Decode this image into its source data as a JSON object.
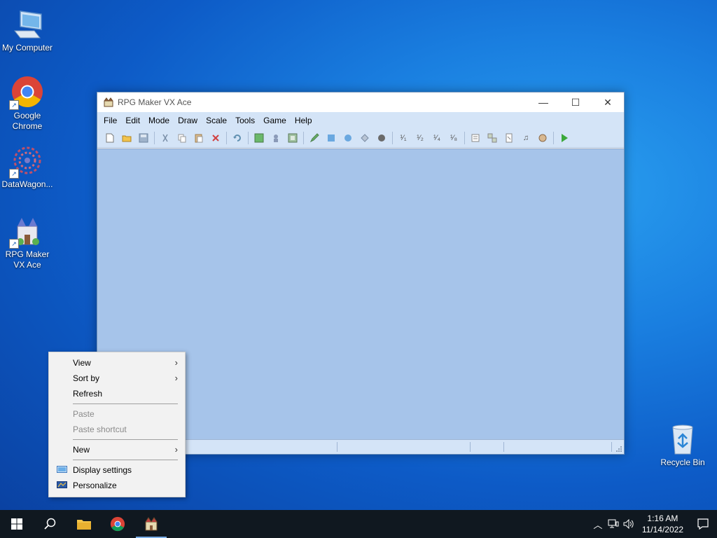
{
  "desktop": {
    "icons": [
      {
        "label": "My Computer",
        "icon": "computer-icon"
      },
      {
        "label": "Google Chrome",
        "icon": "chrome-icon"
      },
      {
        "label": "DataWagon...",
        "icon": "datawagon-icon"
      },
      {
        "label": "RPG Maker VX Ace",
        "icon": "rpgmaker-icon"
      },
      {
        "label": "Recycle Bin",
        "icon": "recycle-bin-icon"
      }
    ]
  },
  "window": {
    "title": "RPG Maker VX Ace",
    "controls": {
      "minimize": "—",
      "maximize": "☐",
      "close": "✕"
    },
    "menu": [
      "File",
      "Edit",
      "Mode",
      "Draw",
      "Scale",
      "Tools",
      "Game",
      "Help"
    ]
  },
  "context_menu": {
    "items": [
      {
        "label": "View",
        "enabled": true,
        "submenu": true
      },
      {
        "label": "Sort by",
        "enabled": true,
        "submenu": true
      },
      {
        "label": "Refresh",
        "enabled": true
      },
      {
        "label": "Paste",
        "enabled": false
      },
      {
        "label": "Paste shortcut",
        "enabled": false
      },
      {
        "label": "New",
        "enabled": true,
        "submenu": true
      },
      {
        "label": "Display settings",
        "enabled": true,
        "icon": "display-icon"
      },
      {
        "label": "Personalize",
        "enabled": true,
        "icon": "personalize-icon"
      }
    ]
  },
  "taskbar": {
    "clock": {
      "time": "1:16 AM",
      "date": "11/14/2022"
    }
  },
  "colors": {
    "accent": "#0d5bc7",
    "taskbar": "#101820",
    "client_area": "#a6c4ea"
  }
}
